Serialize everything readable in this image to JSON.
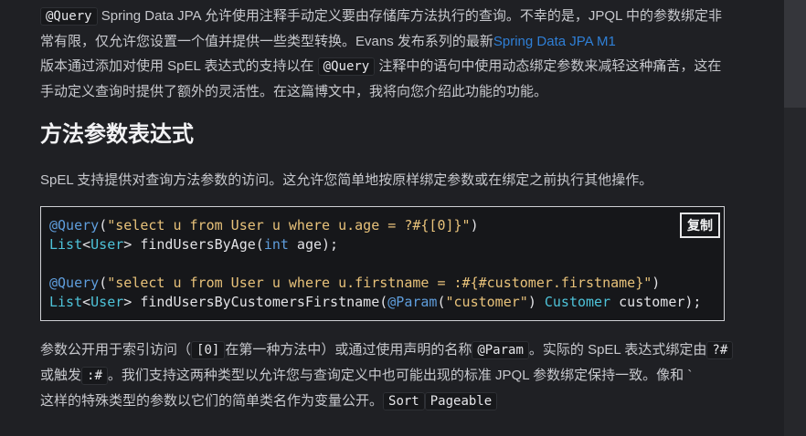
{
  "intro_para": {
    "code1": "@Query",
    "t1": " Spring Data JPA 允许使用注释手动定义要由存储库方法执行的查询。不幸的是，JPQL 中的参数绑定非常有限，仅允许您设置一个值并提供一些类型转换。Evans 发布系列的最新",
    "link": "Spring Data JPA M1",
    "t2": "版本通过添加对使用 SpEL 表达式的支持以在 ",
    "code2": "@Query",
    "t3": " 注释中的语句中使用动态绑定参数来减轻这种痛苦，这在手动定义查询时提供了额外的灵活性。在这篇博文中，我将向您介绍此功能的功能。"
  },
  "heading": "方法参数表达式",
  "spel_para": "SpEL 支持提供对查询方法参数的访问。这允许您简单地按原样绑定参数或在绑定之前执行其他操作。",
  "code": {
    "copy_label": "复制",
    "l1_ann": "@Query",
    "l1_str": "\"select u from User u where u.age = ?#{[0]}\"",
    "l2_type1": "List",
    "l2_type2": "User",
    "l2_rest": " findUsersByAge(",
    "l2_kw": "int",
    "l2_end": " age);",
    "l4_ann": "@Query",
    "l4_str": "\"select u from User u where u.firstname = :#{#customer.firstname}\"",
    "l5_type1": "List",
    "l5_type2": "User",
    "l5_rest": " findUsersByCustomersFirstname(",
    "l5_ann": "@Param",
    "l5_str": "\"customer\"",
    "l5_type3": "Customer",
    "l5_end": " customer);"
  },
  "after_para": {
    "t1": "参数公开用于索引访问（",
    "c1": "[0]",
    "t2": "在第一种方法中）或通过使用声明的名称",
    "c2": "@Param",
    "t3": "。实际的 SpEL 表达式绑定由",
    "c3": "?#",
    "t4": "或触发",
    "c4": ":#",
    "t5": "。我们支持这两种类型以允许您与查询定义中也可能出现的标准 JPQL 参数绑定保持一致。像和 `",
    "t6": "这样的特殊类型的参数以它们的简单类名作为变量公开。",
    "c5": "Sort",
    "c6": "Pageable"
  }
}
